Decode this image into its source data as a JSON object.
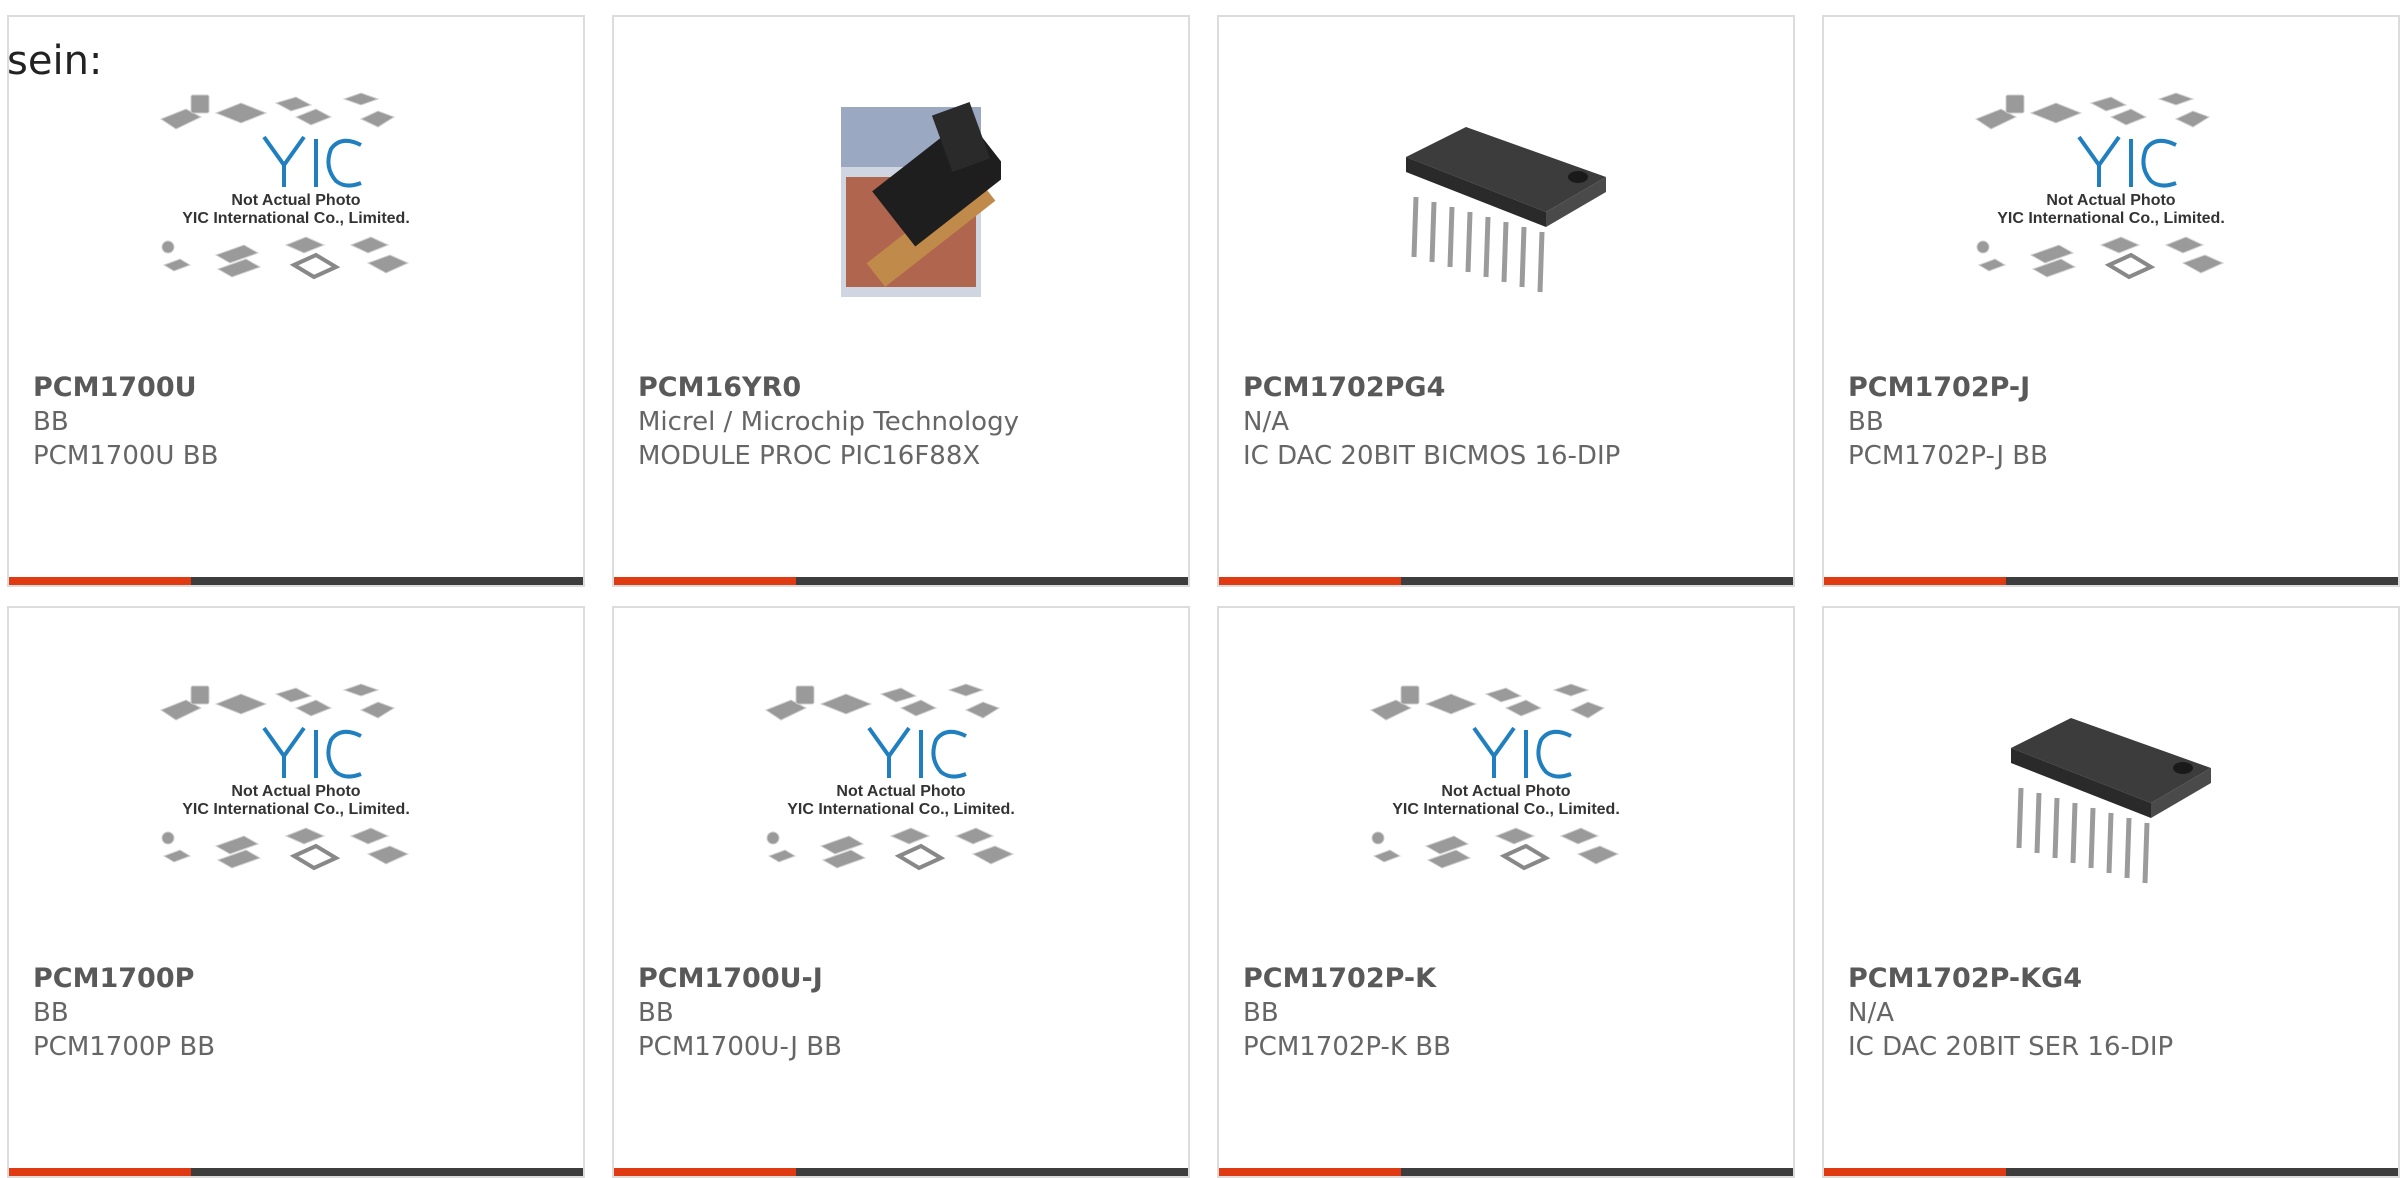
{
  "intro_text": "sein:",
  "placeholder_caption": [
    "Not Actual Photo",
    "YIC International Co., Limited."
  ],
  "placeholder_logo": "YIC",
  "colors": {
    "accent": "#e03a12",
    "bar": "#3d3d3d",
    "border": "#dcdcdc",
    "logo": "#1f7fbf"
  },
  "products": [
    {
      "part_number": "PCM1700U",
      "manufacturer": "BB",
      "description": "PCM1700U BB",
      "image": "placeholder-logo"
    },
    {
      "part_number": "PCM16YR0",
      "manufacturer": "Micrel / Microchip Technology",
      "description": "MODULE PROC PIC16F88X",
      "image": "module-photo"
    },
    {
      "part_number": "PCM1702PG4",
      "manufacturer": "N/A",
      "description": "IC DAC 20BIT BICMOS 16-DIP",
      "image": "dip-chip"
    },
    {
      "part_number": "PCM1702P-J",
      "manufacturer": "BB",
      "description": "PCM1702P-J BB",
      "image": "placeholder-logo"
    },
    {
      "part_number": "PCM1700P",
      "manufacturer": "BB",
      "description": "PCM1700P BB",
      "image": "placeholder-logo"
    },
    {
      "part_number": "PCM1700U-J",
      "manufacturer": "BB",
      "description": "PCM1700U-J BB",
      "image": "placeholder-logo"
    },
    {
      "part_number": "PCM1702P-K",
      "manufacturer": "BB",
      "description": "PCM1702P-K BB",
      "image": "placeholder-logo"
    },
    {
      "part_number": "PCM1702P-KG4",
      "manufacturer": "N/A",
      "description": "IC DAC 20BIT SER 16-DIP",
      "image": "dip-chip"
    }
  ]
}
